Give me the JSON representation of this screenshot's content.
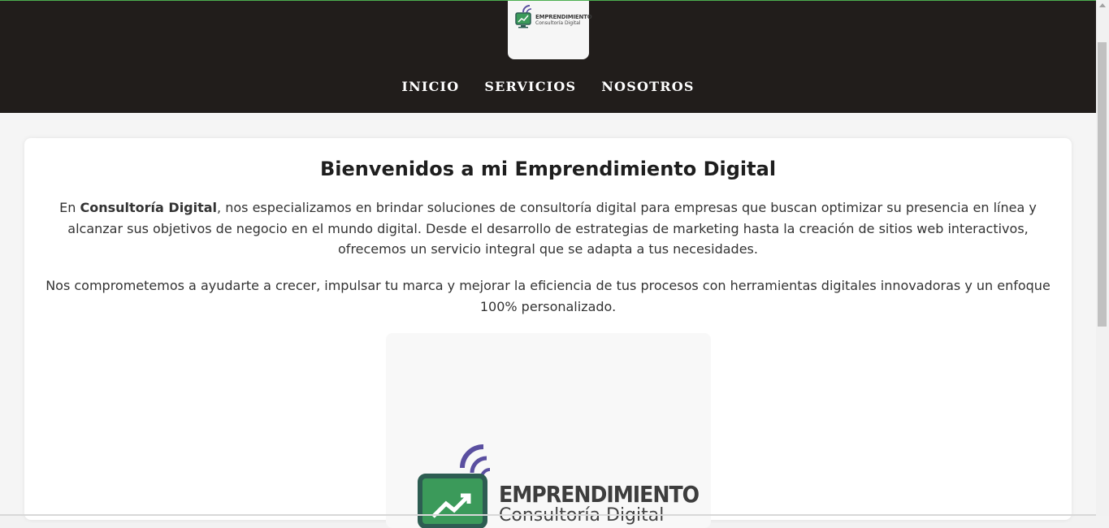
{
  "brand": {
    "name": "EMPRENDIMIENTO",
    "tagline": "Consultoría Digital"
  },
  "nav": {
    "items": [
      {
        "label": "INICIO"
      },
      {
        "label": "SERVICIOS"
      },
      {
        "label": "NOSOTROS"
      }
    ]
  },
  "main": {
    "title": "Bienvenidos a mi Emprendimiento Digital",
    "paragraph1_prefix": "En ",
    "paragraph1_strong": "Consultoría Digital",
    "paragraph1_rest": ", nos especializamos en brindar soluciones de consultoría digital para empresas que buscan optimizar su presencia en línea y alcanzar sus objetivos de negocio en el mundo digital. Desde el desarrollo de estrategias de marketing hasta la creación de sitios web interactivos, ofrecemos un servicio integral que se adapta a tus necesidades.",
    "paragraph2": "Nos comprometemos a ayudarte a crecer, impulsar tu marca y mejorar la eficiencia de tus procesos con herramientas digitales innovadoras y un enfoque 100% personalizado."
  },
  "colors": {
    "header_bg": "#211d1b",
    "logo_purple": "#5a4fa0",
    "logo_green": "#3b9a5a"
  },
  "icons": {
    "logo": "monitor-growth-signal-icon"
  }
}
